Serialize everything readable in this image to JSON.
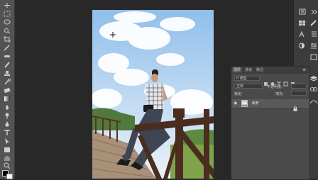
{
  "layers_panel": {
    "tabs": [
      "图层",
      "通道",
      "路径"
    ],
    "filter_kind": "P 类型",
    "blend_mode": "正常",
    "opacity_label": "不透明度:",
    "lock_label": "锁定:",
    "fill_label": "填充:",
    "layer_name": "背景"
  },
  "tools": [
    "move-tool",
    "marquee-tool",
    "lasso-tool",
    "quick-select-tool",
    "crop-tool",
    "eyedropper-tool",
    "healing-brush-tool",
    "brush-tool",
    "clone-stamp-tool",
    "history-brush-tool",
    "eraser-tool",
    "gradient-tool",
    "blur-tool",
    "dodge-tool",
    "pen-tool",
    "type-tool",
    "path-select-tool",
    "shape-tool",
    "hand-tool",
    "zoom-tool"
  ],
  "dock_icons": [
    "history-icon",
    "swatches-icon",
    "brush-presets-icon",
    "character-icon",
    "paragraph-icon",
    "adjustments-icon",
    "properties-icon"
  ],
  "colors": {
    "foreground": "#000000",
    "background": "#ffffff",
    "sky": "#8fbfeb",
    "rail": "#4a2d1e"
  }
}
